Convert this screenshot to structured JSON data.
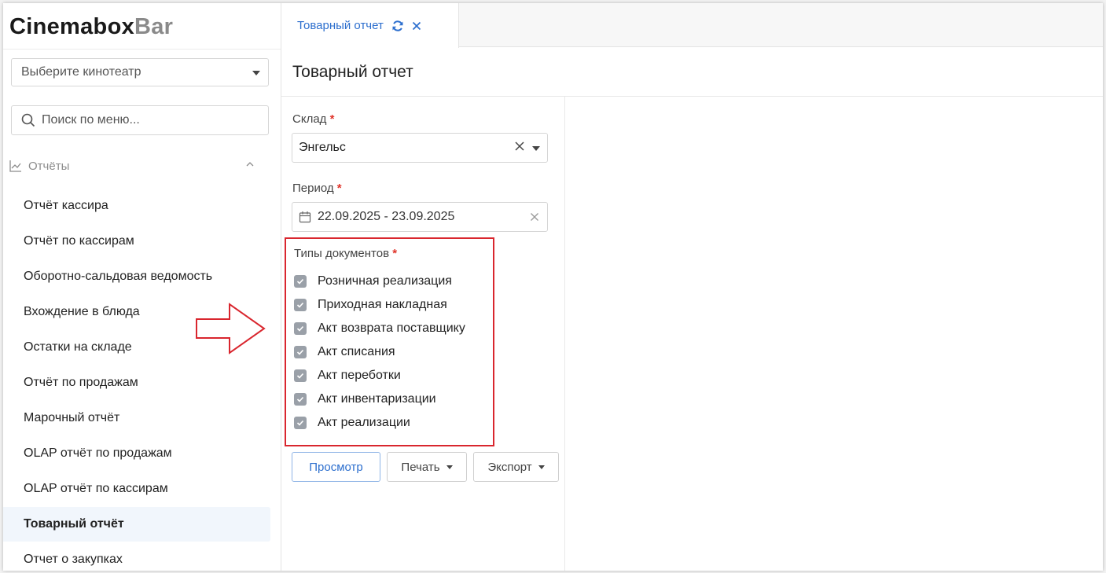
{
  "logo": {
    "main": "Cinemabox",
    "accent": "Bar"
  },
  "cinema_select": {
    "placeholder": "Выберите кинотеатр"
  },
  "menu_search": {
    "placeholder": "Поиск по меню..."
  },
  "sidebar": {
    "section_label": "Отчёты",
    "items": [
      {
        "label": "Отчёт кассира"
      },
      {
        "label": "Отчёт по кассирам"
      },
      {
        "label": "Оборотно-сальдовая ведомость"
      },
      {
        "label": "Вхождение в блюда"
      },
      {
        "label": "Остатки на складе"
      },
      {
        "label": "Отчёт по продажам"
      },
      {
        "label": "Марочный отчёт"
      },
      {
        "label": "OLAP отчёт по продажам"
      },
      {
        "label": "OLAP отчёт по кассирам"
      },
      {
        "label": "Товарный отчёт",
        "active": true
      },
      {
        "label": "Отчет о закупках"
      }
    ]
  },
  "tab": {
    "label": "Товарный отчет"
  },
  "page": {
    "title": "Товарный отчет"
  },
  "form": {
    "warehouse": {
      "label": "Склад",
      "required_mark": "*",
      "value": "Энгельс"
    },
    "period": {
      "label": "Период",
      "required_mark": "*",
      "value": "22.09.2025 - 23.09.2025"
    },
    "doc_types": {
      "label": "Типы документов",
      "required_mark": "*",
      "options": [
        {
          "label": "Розничная реализация",
          "checked": true
        },
        {
          "label": "Приходная накладная",
          "checked": true
        },
        {
          "label": "Акт возврата поставщику",
          "checked": true
        },
        {
          "label": "Акт списания",
          "checked": true
        },
        {
          "label": "Акт переботки",
          "checked": true
        },
        {
          "label": "Акт инвентаризации",
          "checked": true
        },
        {
          "label": "Акт реализации",
          "checked": true
        }
      ]
    }
  },
  "actions": {
    "view": "Просмотр",
    "print": "Печать",
    "export": "Экспорт"
  },
  "colors": {
    "accent": "#2d6fce",
    "highlight": "#d9262e",
    "active_bg": "#f1f6fc"
  }
}
